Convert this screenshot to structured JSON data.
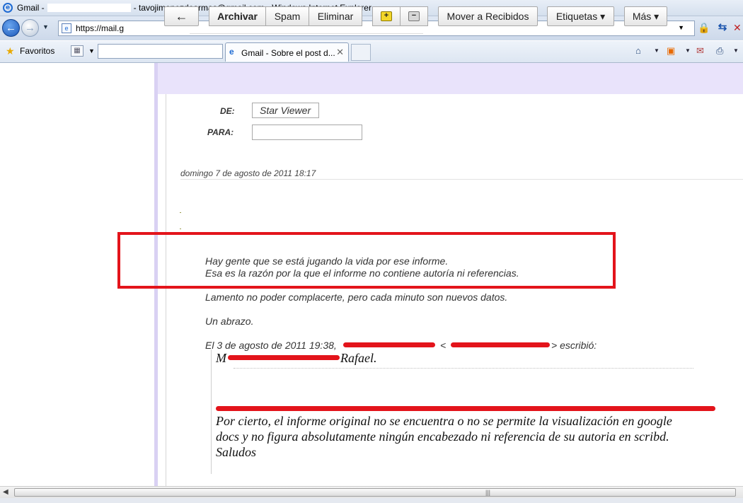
{
  "window": {
    "title_prefix": "Gmail -",
    "title_suffix": "- tavojimenezdearmas@gmail.com - Windows Internet Explorer"
  },
  "address": {
    "url": "https://mail.g"
  },
  "favorites": {
    "label": "Favoritos"
  },
  "tab": {
    "title": "Gmail - Sobre el post d..."
  },
  "toolbar": {
    "back_icon": "←",
    "archive": "Archivar",
    "spam": "Spam",
    "delete": "Eliminar",
    "move_inbox": "Mover a Recibidos",
    "labels": "Etiquetas ▾",
    "more": "Más ▾"
  },
  "message": {
    "from_label": "DE:",
    "from_value": "Star Viewer",
    "to_label": "PARA:",
    "to_value": "",
    "date": "domingo 7 de agosto de 2011 18:17",
    "body_line1": "Hay gente que se está jugando la vida por ese informe.",
    "body_line2": "Esa es la razón por la que el informe no contiene autoría ni referencias.",
    "body_line3": "Lamento no poder complacerte, pero cada minuto son nuevos datos.",
    "body_line4": "Un abrazo.",
    "quote_header_left": "El 3 de agosto de 2011 19:38,",
    "quote_header_mid": "<",
    "quote_header_right": "> escribió:",
    "quoted_first_char": "M",
    "quoted_name": "Rafael.",
    "quoted_line1": "Por cierto, el informe original no se encuentra o no se permite la visualización en google",
    "quoted_line2": "docs y no figura absolutamente ningún encabezado ni referencia de su autoria en scribd.",
    "quoted_line3": "Saludos"
  },
  "colors": {
    "highlight_frame": "#e3141b",
    "toolbar_bg": "#e9e3fb"
  }
}
